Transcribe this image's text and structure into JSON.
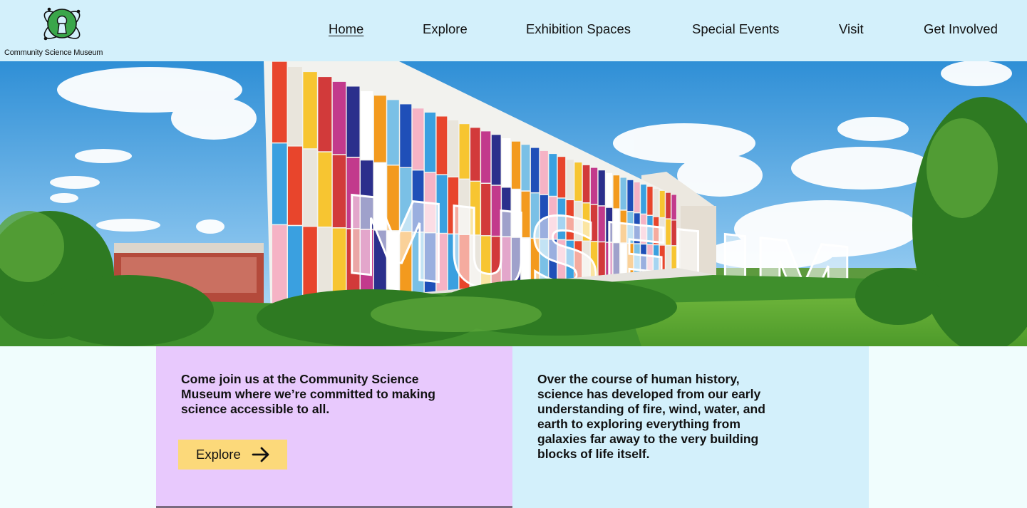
{
  "brand": {
    "name": "Community Science Museum",
    "logo_icon": "atom-keyhole-logo",
    "colors": {
      "header_bg": "#d3f0fb",
      "left_panel_bg": "#e8c9fd",
      "right_panel_bg": "#d3f0fb",
      "button_bg": "#fcd97a",
      "logo_green": "#3aa64a"
    }
  },
  "nav": {
    "items": [
      {
        "label": "Home",
        "active": true
      },
      {
        "label": "Explore",
        "active": false
      },
      {
        "label": "Exhibition Spaces",
        "active": false
      },
      {
        "label": "Special Events",
        "active": false
      },
      {
        "label": "Visit",
        "active": false
      },
      {
        "label": "Get Involved",
        "active": false
      }
    ]
  },
  "hero": {
    "image": "colorful-museum-building-photo",
    "sign_text": "MUSEUM"
  },
  "intro": {
    "text": "Come join us at the Community Science Museum where we’re committed to making science accessible to all.",
    "button_label": "Explore",
    "button_icon": "arrow-right-icon"
  },
  "history": {
    "text": "Over the course of human history, science has developed from our early understanding of fire, wind, water, and earth to exploring everything from galaxies far away to the very building blocks of life itself."
  }
}
